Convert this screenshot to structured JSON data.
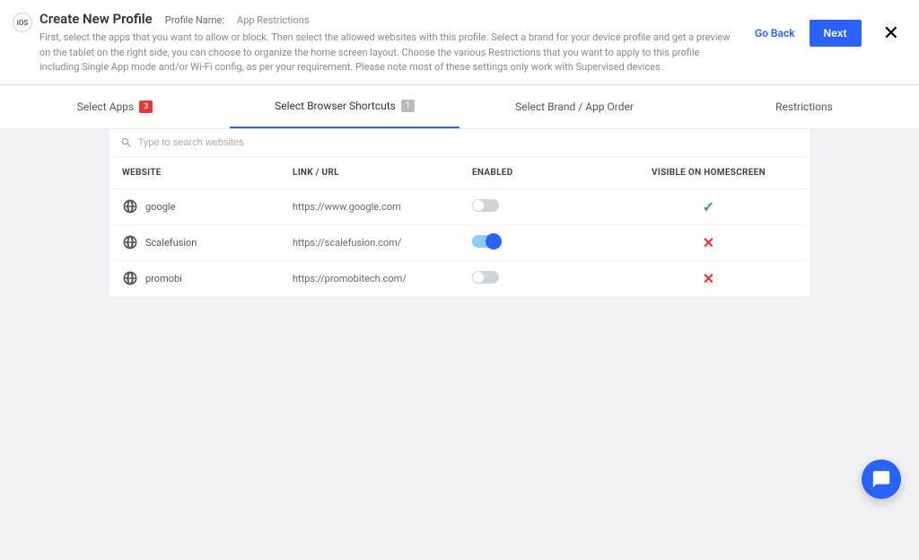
{
  "header": {
    "platform_badge": "iOS",
    "title": "Create New Profile",
    "profile_name_label": "Profile Name:",
    "profile_name_value": "App Restrictions",
    "description": "First, select the apps that you want to allow or block. Then select the allowed websites with this profile. Select a brand for your device profile and get a preview on the tablet on the right side, you can choose to organize the home screen layout. Choose the various Restrictions that you want to apply to this profile including Single App mode and/or Wi-Fi config, as per your requirement. Please note most of these settings only work with Supervised devices.",
    "go_back": "Go Back",
    "next": "Next"
  },
  "tabs": [
    {
      "label": "Select Apps",
      "badge": "3",
      "badge_style": "red",
      "active": false
    },
    {
      "label": "Select Browser Shortcuts",
      "badge": "1",
      "badge_style": "grey",
      "active": true
    },
    {
      "label": "Select Brand / App Order",
      "badge": null,
      "active": false
    },
    {
      "label": "Restrictions",
      "badge": null,
      "active": false
    }
  ],
  "search": {
    "placeholder": "Type to search websites"
  },
  "table": {
    "columns": {
      "website": "WEBSITE",
      "url": "LINK / URL",
      "enabled": "ENABLED",
      "visible": "VISIBLE ON HOMESCREEN"
    },
    "rows": [
      {
        "name": "google",
        "url": "https://www.google.com",
        "enabled": false,
        "visible": true
      },
      {
        "name": "Scalefusion",
        "url": "https://scalefusion.com/",
        "enabled": true,
        "visible": false
      },
      {
        "name": "promobi",
        "url": "https://promobitech.com/",
        "enabled": false,
        "visible": false
      }
    ]
  }
}
